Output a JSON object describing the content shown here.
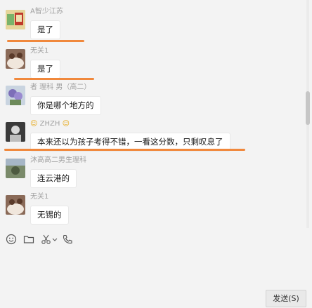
{
  "messages": [
    {
      "sender": "A智少江苏",
      "text": "是了"
    },
    {
      "sender": "无关1",
      "text": "是了"
    },
    {
      "sender": "者 理科 男（高二）",
      "text": "你是哪个地方的"
    },
    {
      "sender": "ZHZH",
      "text": "本来还以为孩子考得不错，一看这分数，只剩叹息了"
    },
    {
      "sender": "沐高高二男生理科",
      "text": "连云港的"
    },
    {
      "sender": "无关1",
      "text": "无锡的"
    }
  ],
  "toolbar": {
    "icons": [
      "emoji-icon",
      "folder-icon",
      "scissors-icon",
      "phone-icon"
    ]
  },
  "send_button": {
    "label": "发送(S)"
  },
  "colors": {
    "annotation": "#f0883c",
    "bubble": "#ffffff",
    "background": "#f3f3f3"
  }
}
